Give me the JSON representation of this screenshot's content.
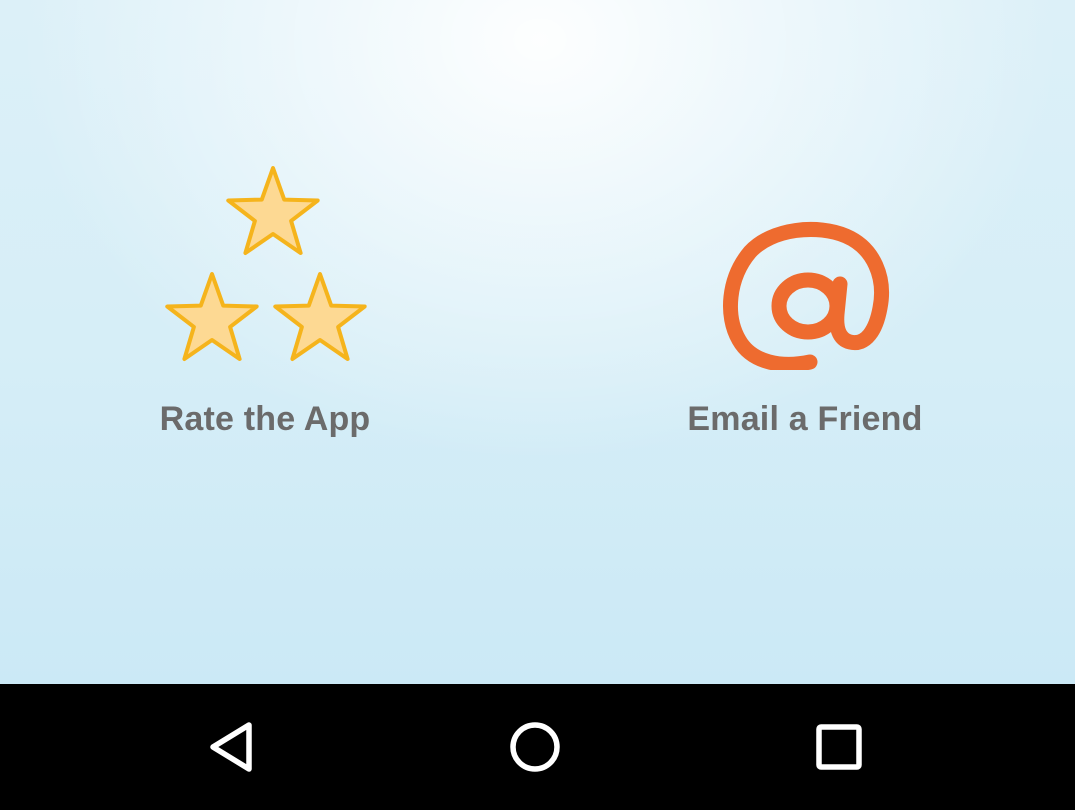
{
  "options": [
    {
      "label": "Rate the App",
      "icon": "three-stars-icon",
      "icon_color": "#fcd88e",
      "icon_stroke": "#f6b51e"
    },
    {
      "label": "Email a Friend",
      "icon": "at-sign-icon",
      "icon_color": "#ee6b2f"
    }
  ],
  "nav_bar": {
    "buttons": [
      "back-icon",
      "home-icon",
      "recents-icon"
    ],
    "icon_color": "#ffffff",
    "background": "#000000"
  },
  "colors": {
    "label_text": "#6b6b6b",
    "background_top": "#ffffff",
    "background": "#d6eef7"
  }
}
